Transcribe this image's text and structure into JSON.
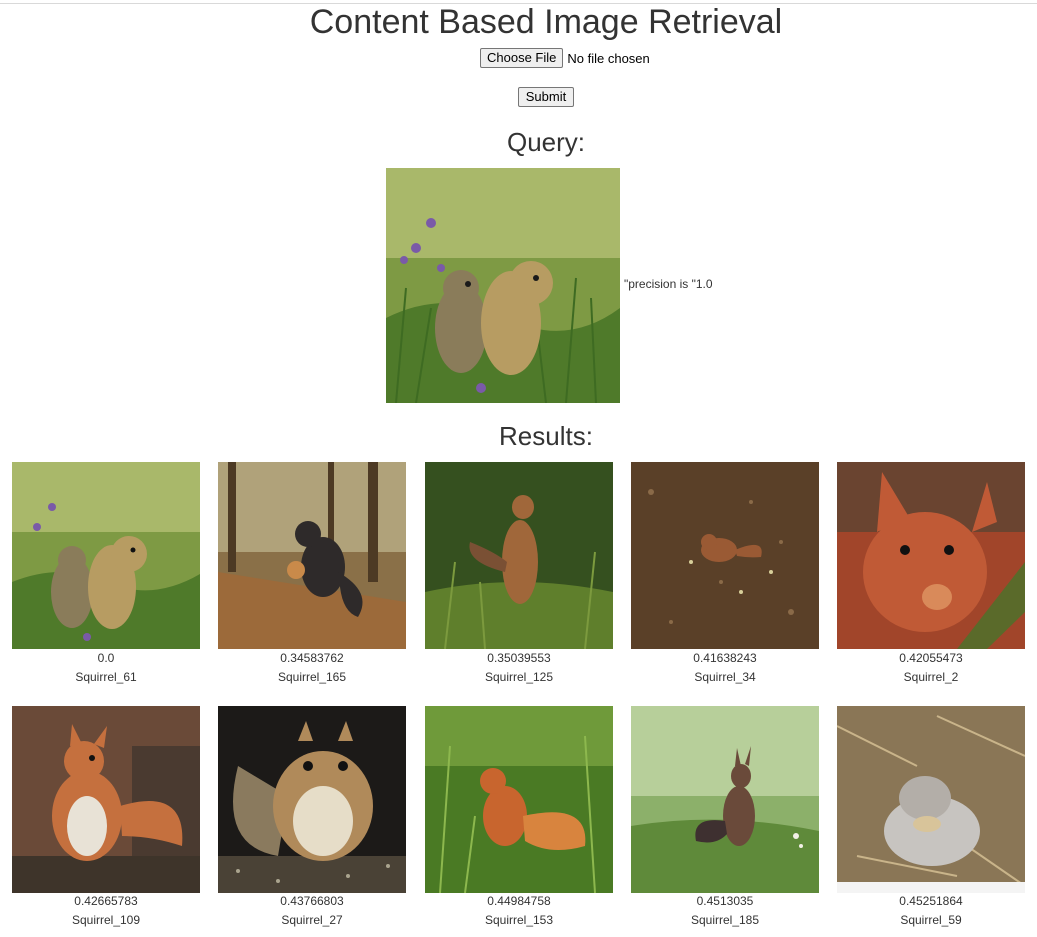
{
  "page": {
    "title": "Content Based Image Retrieval"
  },
  "upload": {
    "button_label": "Choose File",
    "status_text": "No file chosen",
    "submit_label": "Submit"
  },
  "query": {
    "heading": "Query:",
    "image_icon": "ground-squirrels-image",
    "precision_text": "\"precision is \"1.0"
  },
  "results": {
    "heading": "Results:",
    "items": [
      {
        "score": "0.0",
        "label": "Squirrel_61"
      },
      {
        "score": "0.34583762",
        "label": "Squirrel_165"
      },
      {
        "score": "0.35039553",
        "label": "Squirrel_125"
      },
      {
        "score": "0.41638243",
        "label": "Squirrel_34"
      },
      {
        "score": "0.42055473",
        "label": "Squirrel_2"
      },
      {
        "score": "0.42665783",
        "label": "Squirrel_109"
      },
      {
        "score": "0.43766803",
        "label": "Squirrel_27"
      },
      {
        "score": "0.44984758",
        "label": "Squirrel_153"
      },
      {
        "score": "0.4513035",
        "label": "Squirrel_185"
      },
      {
        "score": "0.45251864",
        "label": "Squirrel_59"
      }
    ]
  },
  "colors": {
    "text": "#333333",
    "grass": "#6f8f3a",
    "squirrel_red": "#b5512a",
    "squirrel_grey": "#8a8580"
  }
}
